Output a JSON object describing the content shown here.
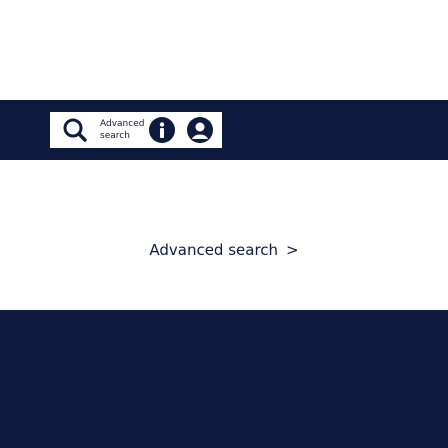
{
  "header": {
    "search_label_line1": "Advanced",
    "search_label_line2": "search"
  },
  "icons": {
    "search": "search-icon",
    "info": "info-icon",
    "user": "user-icon",
    "chevron": "chevron-right-icon"
  },
  "main": {
    "advanced_search_label": "Advanced search",
    "chevron_glyph": ">"
  },
  "colors": {
    "navy": "#0d1b3e",
    "white": "#ffffff"
  }
}
